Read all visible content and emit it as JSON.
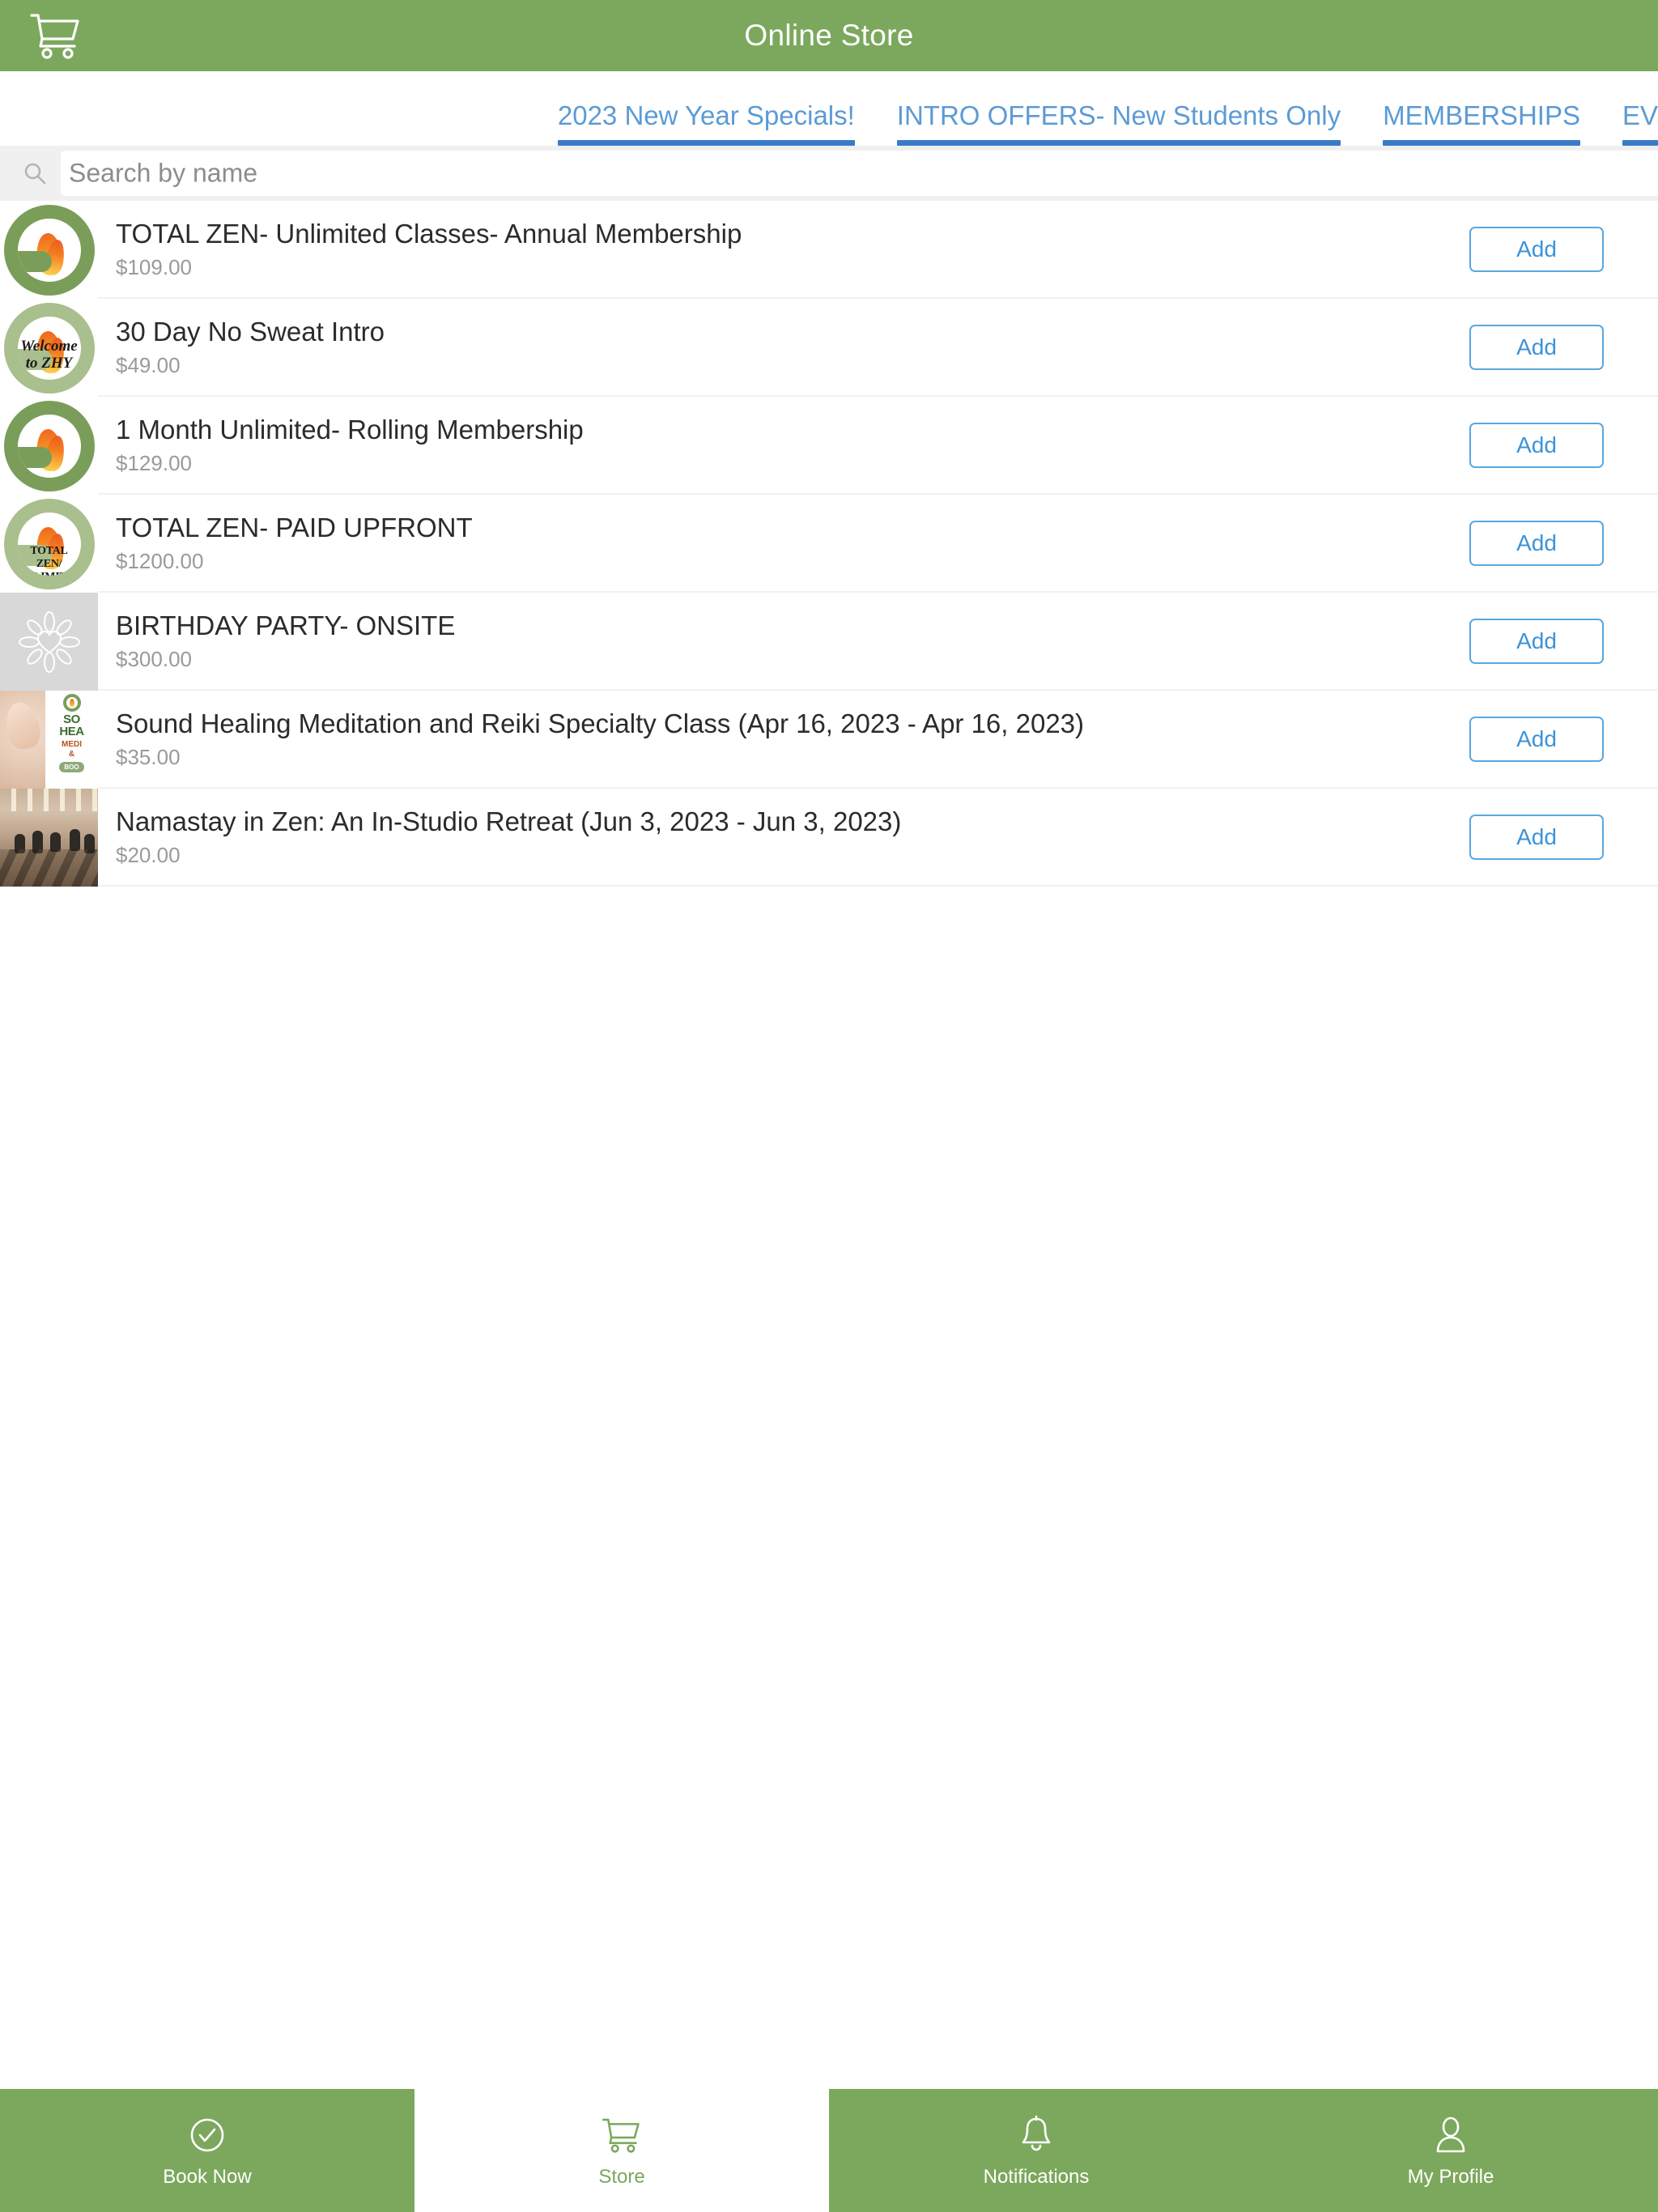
{
  "header": {
    "title": "Online Store",
    "cart_icon": "shopping-cart-icon",
    "background_color": "#7ca85d"
  },
  "tabs": {
    "accent_color": "#5b9bd5",
    "underline_color": "#3a7bc8",
    "items": [
      {
        "label": "2023 New Year Specials!"
      },
      {
        "label": "INTRO OFFERS- New Students Only"
      },
      {
        "label": "MEMBERSHIPS"
      },
      {
        "label": "EV"
      }
    ]
  },
  "search": {
    "placeholder": "Search by name",
    "value": "",
    "icon": "search-icon"
  },
  "products": {
    "add_label": "Add",
    "items": [
      {
        "title": "TOTAL ZEN- Unlimited Classes- Annual Membership",
        "price": "$109.00",
        "thumb": "zhy-flame-logo",
        "add_label": "Add"
      },
      {
        "title": "30 Day No Sweat Intro",
        "price": "$49.00",
        "thumb": "zhy-welcome-logo",
        "thumb_text_line1": "Welcome",
        "thumb_text_line2": "to ZHY",
        "add_label": "Add"
      },
      {
        "title": "1 Month Unlimited- Rolling Membership",
        "price": "$129.00",
        "thumb": "zhy-flame-logo",
        "add_label": "Add"
      },
      {
        "title": "TOTAL ZEN- PAID UPFRONT",
        "price": "$1200.00",
        "thumb": "zhy-totalzen-logo",
        "thumb_text_line1": "TOTAL ZEN/",
        "thumb_text_line2": "UNLIMITED",
        "add_label": "Add"
      },
      {
        "title": "BIRTHDAY PARTY- ONSITE",
        "price": "$300.00",
        "thumb": "mandala-heart-placeholder",
        "add_label": "Add"
      },
      {
        "title": "Sound Healing Meditation and Reiki Specialty Class (Apr 16, 2023 - Apr 16, 2023)",
        "price": "$35.00",
        "thumb": "sound-healing-flyer",
        "thumb_text_line1": "SO",
        "thumb_text_line2": "HEA",
        "thumb_text_line3": "MEDI",
        "thumb_text_line4": "&",
        "thumb_text_line5": "BOO",
        "add_label": "Add"
      },
      {
        "title": "Namastay in Zen: An In-Studio Retreat (Jun 3, 2023 - Jun 3, 2023)",
        "price": "$20.00",
        "thumb": "studio-class-photo",
        "add_label": "Add"
      }
    ]
  },
  "bottom_nav": {
    "items": [
      {
        "label": "Book Now",
        "icon": "check-circle-icon",
        "active": false
      },
      {
        "label": "Store",
        "icon": "shopping-cart-icon",
        "active": true
      },
      {
        "label": "Notifications",
        "icon": "bell-icon",
        "active": false
      },
      {
        "label": "My Profile",
        "icon": "person-icon",
        "active": false
      }
    ]
  }
}
